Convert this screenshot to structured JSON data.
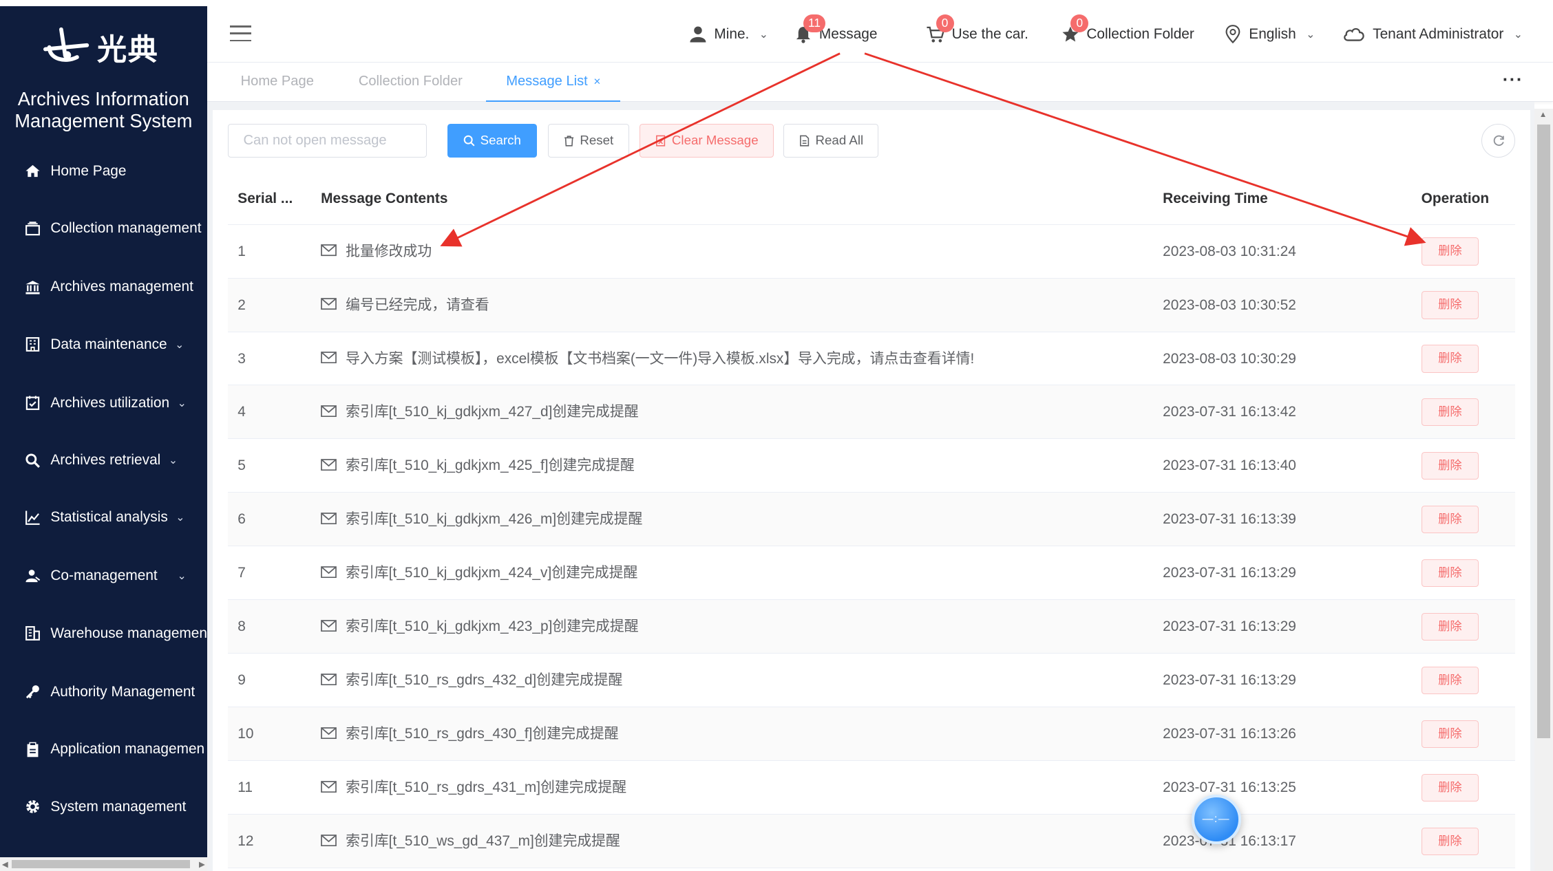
{
  "app": {
    "logo_text": "光典",
    "system_title_line1": "Archives Information",
    "system_title_line2": "Management System"
  },
  "sidebar": {
    "items": [
      {
        "label": "Home Page",
        "icon": "home-icon",
        "has_chevron": false
      },
      {
        "label": "Collection management",
        "icon": "collection-icon",
        "has_chevron": false
      },
      {
        "label": "Archives management",
        "icon": "bank-icon",
        "has_chevron": false
      },
      {
        "label": "Data maintenance",
        "icon": "building-icon",
        "has_chevron": true
      },
      {
        "label": "Archives utilization",
        "icon": "checklist-icon",
        "has_chevron": true
      },
      {
        "label": "Archives retrieval",
        "icon": "search-icon",
        "has_chevron": true
      },
      {
        "label": "Statistical analysis",
        "icon": "line-chart-icon",
        "has_chevron": true
      },
      {
        "label": "Co-management",
        "icon": "users-icon",
        "has_chevron": true
      },
      {
        "label": "Warehouse managemen",
        "icon": "warehouse-icon",
        "has_chevron": false
      },
      {
        "label": "Authority Management",
        "icon": "key-icon",
        "has_chevron": false
      },
      {
        "label": "Application managemen",
        "icon": "clipboard-icon",
        "has_chevron": false
      },
      {
        "label": "System management",
        "icon": "gear-icon",
        "has_chevron": false
      }
    ]
  },
  "header": {
    "mine_label": "Mine.",
    "message_label": "Message",
    "message_badge": "11",
    "car_label": "Use the car.",
    "car_badge": "0",
    "folder_label": "Collection Folder",
    "folder_badge": "0",
    "language_label": "English",
    "user_label": "Tenant Administrator"
  },
  "tabs": [
    {
      "label": "Home Page",
      "active": false
    },
    {
      "label": "Collection Folder",
      "active": false
    },
    {
      "label": "Message List",
      "active": true
    }
  ],
  "tabs_close_symbol": "×",
  "toolbar": {
    "search_placeholder": "Can not open message",
    "search_label": "Search",
    "reset_label": "Reset",
    "clear_label": "Clear Message",
    "read_all_label": "Read All"
  },
  "table": {
    "columns": [
      "Serial ...",
      "Message Contents",
      "Receiving Time",
      "Operation"
    ],
    "delete_label": "删除",
    "rows": [
      {
        "serial": "1",
        "content": "批量修改成功",
        "time": "2023-08-03 10:31:24"
      },
      {
        "serial": "2",
        "content": "编号已经完成，请查看",
        "time": "2023-08-03 10:30:52"
      },
      {
        "serial": "3",
        "content": "导入方案【测试模板】，excel模板【文书档案(一文一件)导入模板.xlsx】导入完成，请点击查看详情!",
        "time": "2023-08-03 10:30:29"
      },
      {
        "serial": "4",
        "content": "索引库[t_510_kj_gdkjxm_427_d]创建完成提醒",
        "time": "2023-07-31 16:13:42"
      },
      {
        "serial": "5",
        "content": "索引库[t_510_kj_gdkjxm_425_f]创建完成提醒",
        "time": "2023-07-31 16:13:40"
      },
      {
        "serial": "6",
        "content": "索引库[t_510_kj_gdkjxm_426_m]创建完成提醒",
        "time": "2023-07-31 16:13:39"
      },
      {
        "serial": "7",
        "content": "索引库[t_510_kj_gdkjxm_424_v]创建完成提醒",
        "time": "2023-07-31 16:13:29"
      },
      {
        "serial": "8",
        "content": "索引库[t_510_kj_gdkjxm_423_p]创建完成提醒",
        "time": "2023-07-31 16:13:29"
      },
      {
        "serial": "9",
        "content": "索引库[t_510_rs_gdrs_432_d]创建完成提醒",
        "time": "2023-07-31 16:13:29"
      },
      {
        "serial": "10",
        "content": "索引库[t_510_rs_gdrs_430_f]创建完成提醒",
        "time": "2023-07-31 16:13:26"
      },
      {
        "serial": "11",
        "content": "索引库[t_510_rs_gdrs_431_m]创建完成提醒",
        "time": "2023-07-31 16:13:25"
      },
      {
        "serial": "12",
        "content": "索引库[t_510_ws_gd_437_m]创建完成提醒",
        "time": "2023-07-31 16:13:17"
      }
    ]
  },
  "floating_widget_text": "—:—",
  "annotation_color": "#e8322b"
}
